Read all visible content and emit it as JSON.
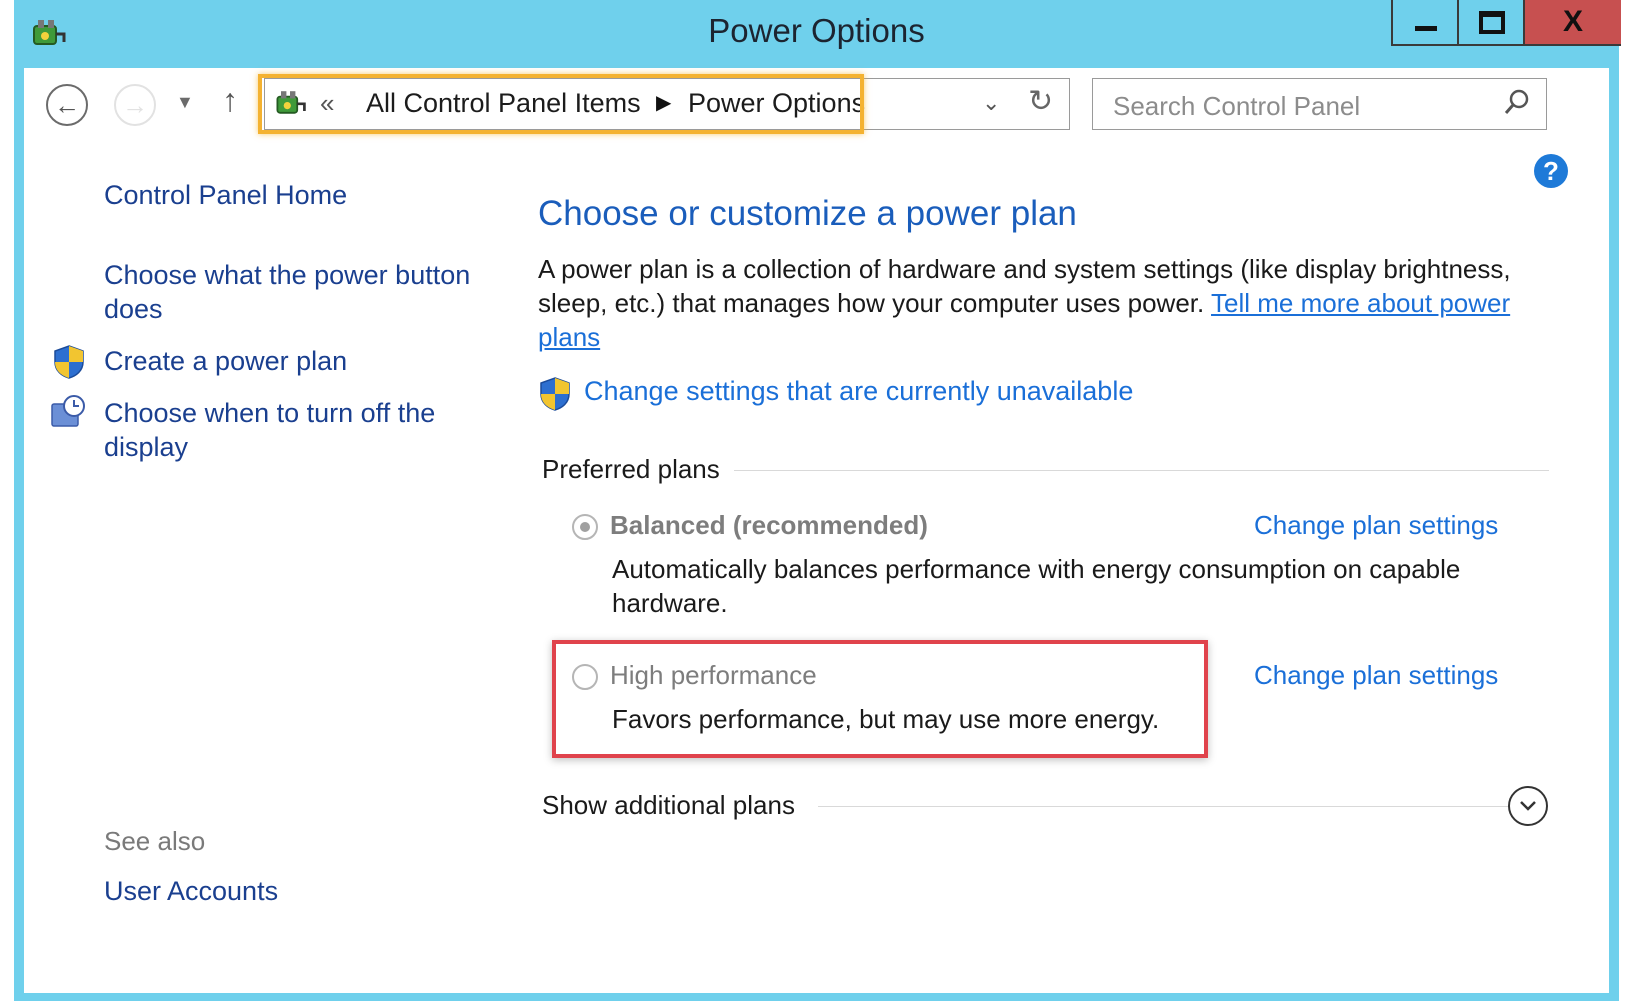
{
  "window": {
    "title": "Power Options",
    "app_icon": "power-options-icon",
    "controls": {
      "minimize": "minimize-icon",
      "maximize": "maximize-icon",
      "close_label": "X"
    }
  },
  "nav": {
    "back_icon": "back-arrow-icon",
    "forward_icon": "forward-arrow-icon",
    "recent_icon": "chevron-down-icon",
    "up_icon": "up-arrow-icon",
    "address": {
      "chevron": "«",
      "crumbs": [
        "All Control Panel Items",
        "Power Options"
      ],
      "separator": "▶"
    },
    "search": {
      "placeholder": "Search Control Panel"
    }
  },
  "help_label": "?",
  "left_pane": {
    "home": "Control Panel Home",
    "links": [
      "Choose what the power button does",
      "Create a power plan",
      "Choose when to turn off the display"
    ],
    "see_also_label": "See also",
    "see_also_links": [
      "User Accounts"
    ]
  },
  "main": {
    "heading": "Choose or customize a power plan",
    "description": "A power plan is a collection of hardware and system settings (like display brightness, sleep, etc.) that manages how your computer uses power.",
    "description_link": "Tell me more about power plans",
    "unavailable_link": "Change settings that are currently unavailable",
    "preferred_label": "Preferred plans",
    "plans": [
      {
        "name": "Balanced (recommended)",
        "selected": true,
        "description": "Automatically balances performance with energy consumption on capable hardware.",
        "link": "Change plan settings"
      },
      {
        "name": "High performance",
        "selected": false,
        "description": "Favors performance, but may use more energy.",
        "link": "Change plan settings"
      }
    ],
    "show_additional_label": "Show additional plans"
  },
  "colors": {
    "titlebar": "#6fd0ec",
    "link": "#1a6fd8",
    "heading": "#1a5dbb",
    "address_highlight": "#f4b231",
    "plan_highlight": "#e0434c",
    "close_button": "#c75050"
  }
}
